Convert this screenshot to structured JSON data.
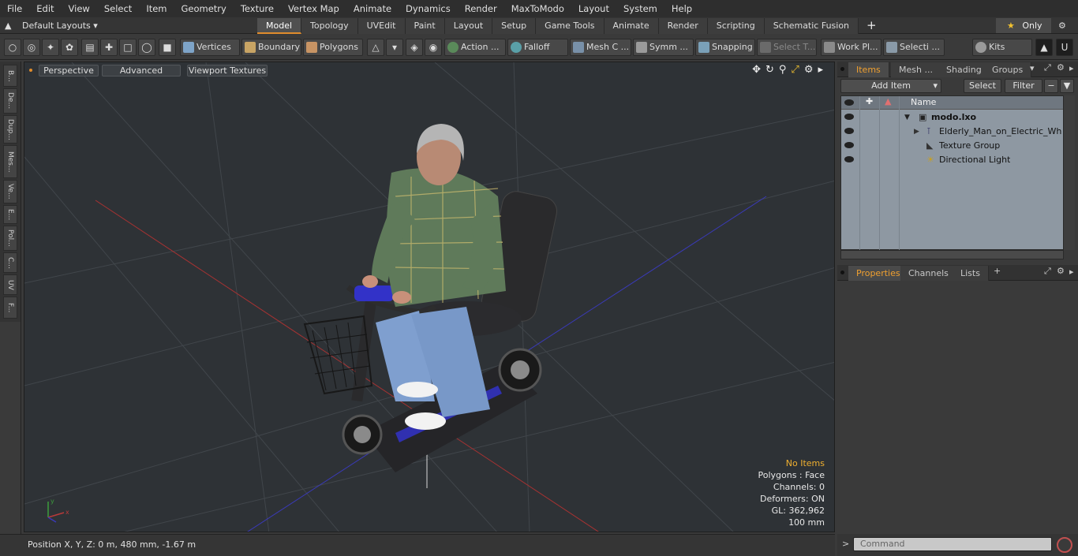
{
  "menu": [
    "File",
    "Edit",
    "View",
    "Select",
    "Item",
    "Geometry",
    "Texture",
    "Vertex Map",
    "Animate",
    "Dynamics",
    "Render",
    "MaxToModo",
    "Layout",
    "System",
    "Help"
  ],
  "layouts": "Default Layouts ▾",
  "tabs": [
    "Model",
    "Topology",
    "UVEdit",
    "Paint",
    "Layout",
    "Setup",
    "Game Tools",
    "Animate",
    "Render",
    "Scripting",
    "Schematic Fusion"
  ],
  "active_tab": "Model",
  "only_label": "Only",
  "toolbar": {
    "vertices": "Vertices",
    "boundary": "Boundary",
    "polygons": "Polygons",
    "action": "Action ...",
    "falloff": "Falloff",
    "mesh": "Mesh C ...",
    "symm": "Symm ...",
    "snapping": "Snapping",
    "select_t": "Select T...",
    "workpl": "Work Pl...",
    "selecti": "Selecti ...",
    "kits": "Kits"
  },
  "left_tabs": [
    "B...",
    "De...",
    "Dup...",
    "Mes...",
    "Ve...",
    "E...",
    "Pol...",
    "C...",
    "UV",
    "F..."
  ],
  "viewport": {
    "perspective": "Perspective",
    "advanced": "Advanced",
    "textures": "Viewport Textures",
    "hud": {
      "items": "No Items",
      "polygons": "Polygons : Face",
      "channels": "Channels: 0",
      "deformers": "Deformers: ON",
      "gl": "GL: 362,962",
      "unit": "100 mm"
    }
  },
  "status": "Position X, Y, Z:  0 m, 480 mm, -1.67 m",
  "items_panel": {
    "tabs": [
      "Items",
      "Mesh ...",
      "Shading",
      "Groups"
    ],
    "add_item": "Add Item",
    "select": "Select",
    "filter": "Filter",
    "name_header": "Name",
    "rows": [
      {
        "label": "modo.lxo"
      },
      {
        "label": "Elderly_Man_on_Electric_Wh ..."
      },
      {
        "label": "Texture Group"
      },
      {
        "label": "Directional Light"
      }
    ]
  },
  "props_panel": {
    "tabs": [
      "Properties",
      "Channels",
      "Lists"
    ]
  },
  "command_placeholder": "Command",
  "colors": {
    "accent": "#e08c2c",
    "grid_red": "#b03030",
    "grid_blue": "#3a3ab8"
  }
}
